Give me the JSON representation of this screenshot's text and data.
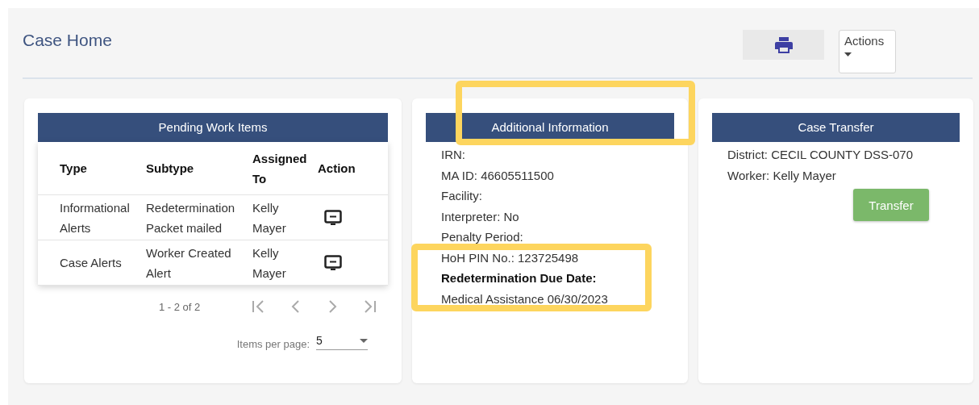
{
  "page": {
    "title": "Case Home"
  },
  "toolbar": {
    "actions_label": "Actions"
  },
  "pending": {
    "title": "Pending Work Items",
    "columns": [
      "Type",
      "Subtype",
      "Assigned To",
      "Action"
    ],
    "rows": [
      {
        "type": "Informational Alerts",
        "subtype": "Redetermination Packet mailed",
        "assigned_to": "Kelly Mayer"
      },
      {
        "type": "Case Alerts",
        "subtype": "Worker Created Alert",
        "assigned_to": "Kelly Mayer"
      }
    ],
    "range": "1 - 2 of 2",
    "items_per_page_label": "Items per page:",
    "items_per_page": "5"
  },
  "additional": {
    "title": "Additional Information",
    "lines": [
      {
        "text": "IRN:",
        "bold": false
      },
      {
        "text": "MA ID: 46605511500",
        "bold": false
      },
      {
        "text": "Facility:",
        "bold": false
      },
      {
        "text": "Interpreter: No",
        "bold": false
      },
      {
        "text": "Penalty Period:",
        "bold": false
      },
      {
        "text": "HoH PIN No.: 123725498",
        "bold": false
      },
      {
        "text": "Redetermination Due Date:",
        "bold": true
      },
      {
        "text": "Medical Assistance 06/30/2023",
        "bold": false
      }
    ]
  },
  "transfer": {
    "title": "Case Transfer",
    "lines": [
      "District: CECIL COUNTY DSS-070",
      "Worker: Kelly Mayer"
    ],
    "button": "Transfer"
  }
}
